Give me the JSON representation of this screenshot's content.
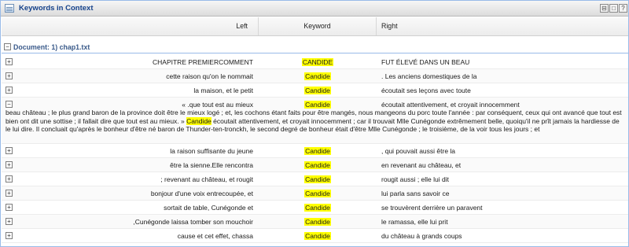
{
  "window": {
    "title": "Keywords in Context",
    "tools": [
      "⊟",
      "□",
      "?"
    ]
  },
  "columns": {
    "left": "Left",
    "keyword": "Keyword",
    "right": "Right"
  },
  "group": {
    "toggle": "−",
    "label": "Document: 1) chap1.txt"
  },
  "rows": [
    {
      "toggle": "+",
      "left": "CHAPITRE PREMIERCOMMENT",
      "keyword": "CANDIDE",
      "right": "FUT ÉLEVÉ DANS UN BEAU"
    },
    {
      "toggle": "+",
      "left": "cette raison qu'on le nommait",
      "keyword": "Candide",
      "right": ". Les anciens domestiques de la"
    },
    {
      "toggle": "+",
      "left": "la maison, et le petit",
      "keyword": "Candide",
      "right": "écoutait ses leçons avec toute"
    },
    {
      "toggle": "−",
      "left": "« .que tout est au mieux",
      "keyword": "Candide",
      "right": "écoutait attentivement, et croyait innocemment",
      "context_before": "beau château ; le plus grand baron de la province doit être le mieux logé ; et, les cochons étant faits pour être mangés, nous mangeons du porc toute l'année : par conséquent, ceux qui ont avancé que tout est bien ont dit une sottise ; il fallait dire que tout est au mieux. » ",
      "context_keyword": "Candide",
      "context_after": " écoutait attentivement, et croyait innocemment ; car il trouvait Mlle Cunégonde extrêmement belle, quoiqu'il ne prît jamais la hardiesse de le lui dire. Il concluait qu'après le bonheur d'être né baron de Thunder-ten-tronckh, le second degré de bonheur était d'être Mlle Cunégonde ; le troisième, de la voir tous les jours ; et"
    },
    {
      "toggle": "+",
      "left": "la raison suffisante du jeune",
      "keyword": "Candide",
      "right": ", qui pouvait aussi être la"
    },
    {
      "toggle": "+",
      "left": "être la sienne.Elle rencontra",
      "keyword": "Candide",
      "right": "en revenant au château, et"
    },
    {
      "toggle": "+",
      "left": "; revenant au château, et rougit",
      "keyword": "Candide",
      "right": "rougit aussi ; elle lui dit"
    },
    {
      "toggle": "+",
      "left": "bonjour d'une voix entrecoupée, et",
      "keyword": "Candide",
      "right": "lui parla sans savoir ce"
    },
    {
      "toggle": "+",
      "left": "sortait de table, Cunégonde et",
      "keyword": "Candide",
      "right": "se trouvèrent derrière un paravent"
    },
    {
      "toggle": "+",
      "left": ",Cunégonde laissa tomber son mouchoir",
      "keyword": "Candide",
      "right": "le ramassa, elle lui prit"
    },
    {
      "toggle": "+",
      "left": "cause et cet effet, chassa",
      "keyword": "Candide",
      "right": "du château à grands coups"
    }
  ],
  "colors": {
    "highlight": "#ffff00",
    "title_text": "#15428b",
    "group_text": "#3a5a8a"
  }
}
